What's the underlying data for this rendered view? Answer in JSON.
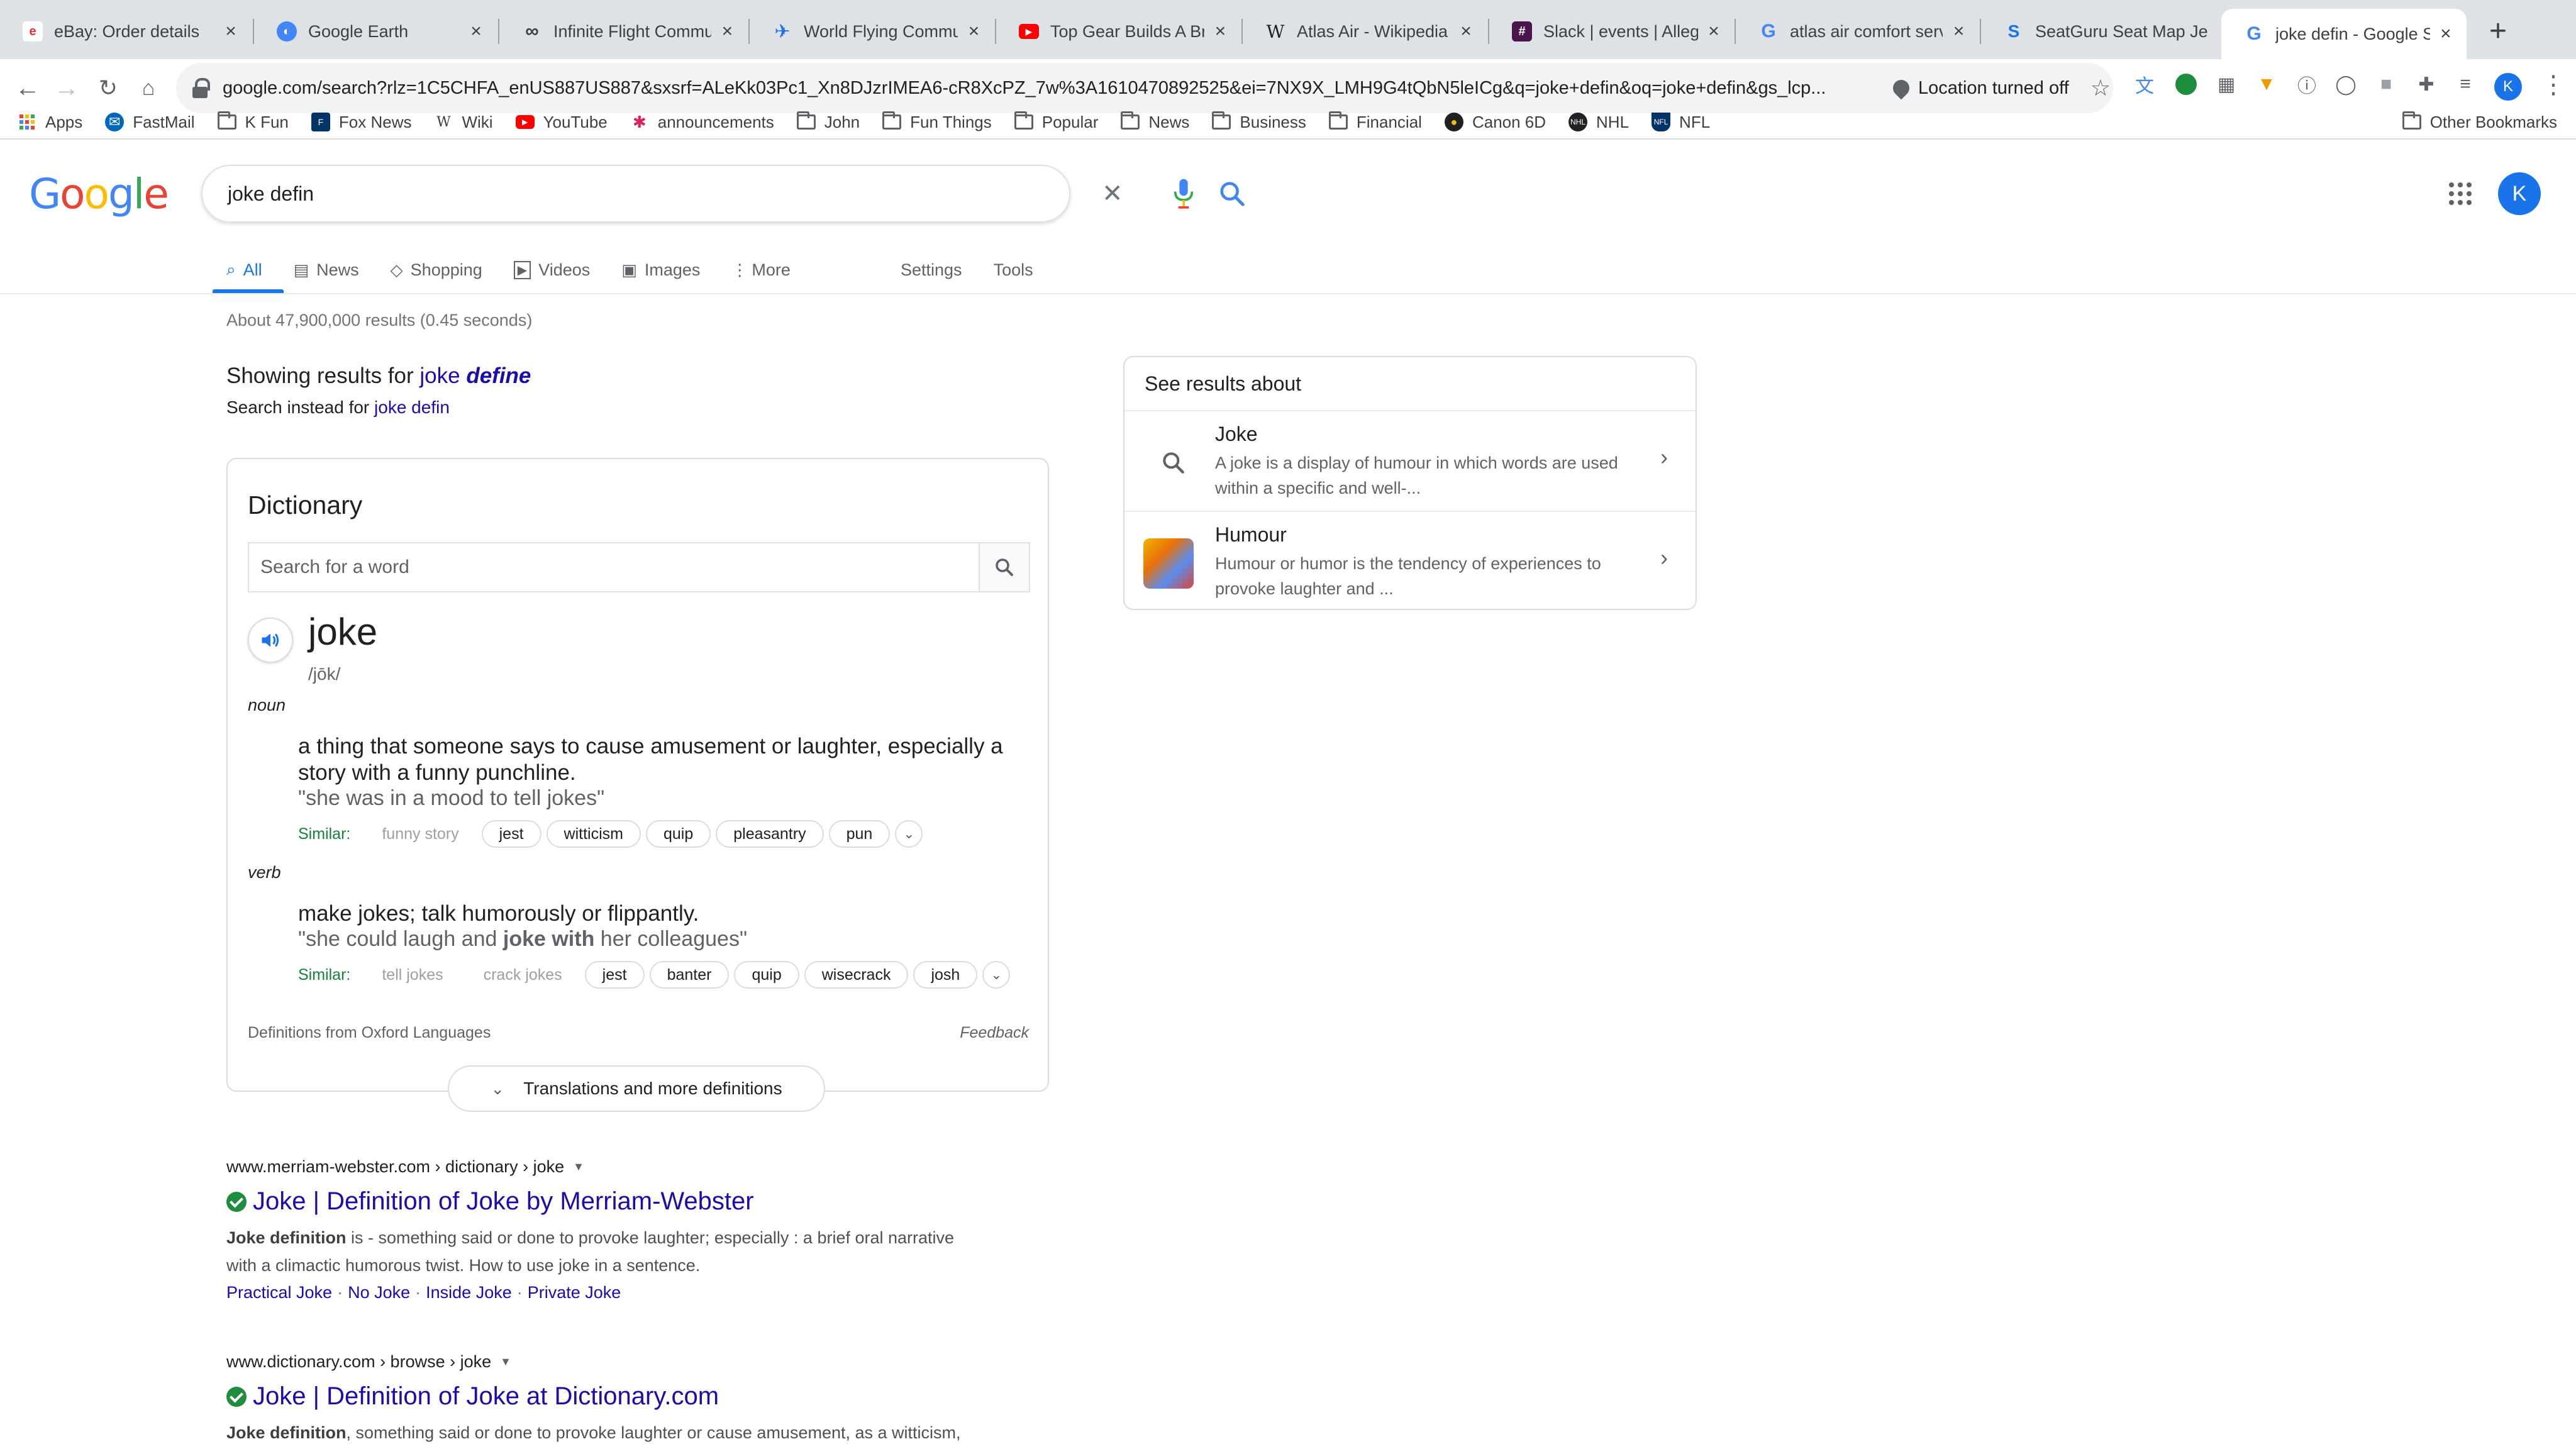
{
  "browser": {
    "tabs": [
      {
        "title": "eBay: Order details",
        "favicon_color": "#e53238",
        "favicon": "e"
      },
      {
        "title": "Google Earth",
        "favicon_color": "#4285f4",
        "favicon": "◐"
      },
      {
        "title": "Infinite Flight Communi",
        "favicon_color": "#5f6368",
        "favicon": "∞"
      },
      {
        "title": "World Flying Communi",
        "favicon_color": "#1a73e8",
        "favicon": "✈"
      },
      {
        "title": "Top Gear Builds A Brid",
        "favicon_color": "#ff0000",
        "favicon": "▶"
      },
      {
        "title": "Atlas Air - Wikipedia",
        "favicon_color": "#202124",
        "favicon": "W"
      },
      {
        "title": "Slack | events | Allegian",
        "favicon_color": "#4a154b",
        "favicon": "#"
      },
      {
        "title": "atlas air comfort servic",
        "favicon_color": "#4285f4",
        "favicon": "G"
      },
      {
        "title": "SeatGuru Seat Map Jet",
        "favicon_color": "#1a73e8",
        "favicon": "S"
      },
      {
        "title": "joke defin - Google Sea",
        "favicon_color": "#4285f4",
        "favicon": "G"
      }
    ],
    "url": "google.com/search?rlz=1C5CHFA_enUS887US887&sxsrf=ALeKk03Pc1_Xn8DJzrIMEA6-cR8XcPZ_7w%3A1610470892525&ei=7NX9X_LMH9G4tQbN5leICg&q=joke+defin&oq=joke+defin&gs_lcp...",
    "location_status": "Location turned off",
    "profile_initial": "K",
    "bookmarks": [
      {
        "label": "Apps",
        "icon": "apps-grid"
      },
      {
        "label": "FastMail",
        "icon": "fastmail"
      },
      {
        "label": "K Fun",
        "icon": "folder"
      },
      {
        "label": "Fox News",
        "icon": "fox"
      },
      {
        "label": "Wiki",
        "icon": "wiki"
      },
      {
        "label": "YouTube",
        "icon": "youtube"
      },
      {
        "label": "announcements",
        "icon": "slack"
      },
      {
        "label": "John",
        "icon": "folder"
      },
      {
        "label": "Fun Things",
        "icon": "folder"
      },
      {
        "label": "Popular",
        "icon": "folder"
      },
      {
        "label": "News",
        "icon": "folder"
      },
      {
        "label": "Business",
        "icon": "folder"
      },
      {
        "label": "Financial",
        "icon": "folder"
      },
      {
        "label": "Canon 6D",
        "icon": "canon"
      },
      {
        "label": "NHL",
        "icon": "nhl"
      },
      {
        "label": "NFL",
        "icon": "nfl"
      }
    ],
    "other_bookmarks": "Other Bookmarks"
  },
  "google": {
    "logo": "Google",
    "query": "joke defin",
    "avatar_initial": "K",
    "tabs": [
      {
        "label": "All",
        "icon": "🔍"
      },
      {
        "label": "News",
        "icon": "▤"
      },
      {
        "label": "Shopping",
        "icon": "◇"
      },
      {
        "label": "Videos",
        "icon": "▶"
      },
      {
        "label": "Images",
        "icon": "▣"
      },
      {
        "label": "More",
        "icon": "⋮"
      }
    ],
    "settings": "Settings",
    "tools": "Tools",
    "result_stats": "About 47,900,000 results (0.45 seconds)",
    "showing_prefix": "Showing results for ",
    "showing_word": "joke ",
    "showing_bold": "define",
    "instead_prefix": "Search instead for ",
    "instead_link": "joke defin"
  },
  "dictionary": {
    "title": "Dictionary",
    "search_placeholder": "Search for a word",
    "word": "joke",
    "phonetic": "/jōk/",
    "noun": {
      "pos": "noun",
      "definition": "a thing that someone says to cause amusement or laughter, especially a story with a funny punchline.",
      "example": "\"she was in a mood to tell jokes\"",
      "similar_label": "Similar:",
      "similar": [
        "funny story",
        "jest",
        "witticism",
        "quip",
        "pleasantry",
        "pun"
      ]
    },
    "verb": {
      "pos": "verb",
      "definition": "make jokes; talk humorously or flippantly.",
      "example_pre": "\"she could laugh and ",
      "example_bold": "joke with",
      "example_post": " her colleagues\"",
      "similar_label": "Similar:",
      "similar": [
        "tell jokes",
        "crack jokes",
        "jest",
        "banter",
        "quip",
        "wisecrack",
        "josh"
      ]
    },
    "source": "Definitions from Oxford Languages",
    "feedback": "Feedback",
    "more": "Translations and more definitions"
  },
  "results": [
    {
      "cite": "www.merriam-webster.com › dictionary › joke",
      "title": "Joke | Definition of Joke by Merriam-Webster",
      "snippet_bold": "Joke definition",
      "snippet": " is - something said or done to provoke laughter; especially : a brief oral narrative with a climactic humorous twist. How to use joke in a sentence.",
      "links": [
        "Practical Joke",
        "No Joke",
        "Inside Joke",
        "Private Joke"
      ]
    },
    {
      "cite": "www.dictionary.com › browse › joke",
      "title": "Joke | Definition of Joke at Dictionary.com",
      "snippet_bold": "Joke definition",
      "snippet": ", something said or done to provoke laughter or cause amusement, as a witticism,"
    }
  ],
  "see_results": {
    "title": "See results about",
    "items": [
      {
        "name": "Joke",
        "desc": "A joke is a display of humour in which words are used within a specific and well-..."
      },
      {
        "name": "Humour",
        "desc": "Humour or humor is the tendency of experiences to provoke laughter and ..."
      }
    ]
  },
  "colors": {
    "link": "#1a0dab",
    "accent": "#1a73e8",
    "similar": "#188038"
  }
}
